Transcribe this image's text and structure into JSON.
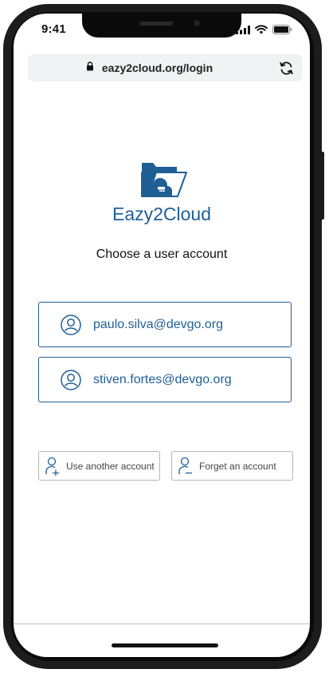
{
  "status": {
    "time": "9:41"
  },
  "browser": {
    "url": "eazy2cloud.org/login"
  },
  "brand": {
    "name": "Eazy2Cloud",
    "color": "#1f5f96"
  },
  "page": {
    "heading": "Choose a user account"
  },
  "accounts": [
    {
      "email": "paulo.silva@devgo.org",
      "icon": "user-avatar-icon"
    },
    {
      "email": "stiven.fortes@devgo.org",
      "icon": "user-avatar-icon"
    }
  ],
  "actions": {
    "use_another": {
      "label": "Use another account",
      "icon": "user-add-icon"
    },
    "forget": {
      "label": "Forget an account",
      "icon": "user-remove-icon"
    }
  }
}
